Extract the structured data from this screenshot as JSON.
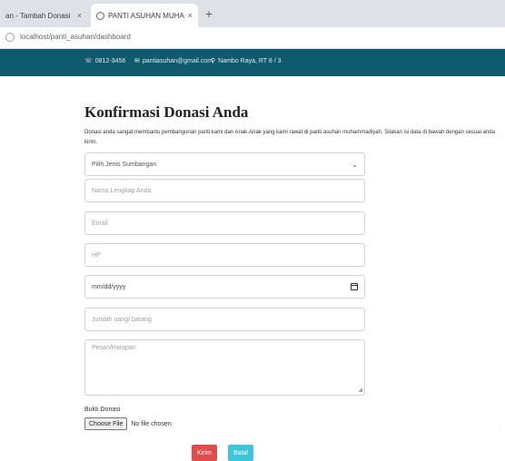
{
  "browser": {
    "tabs": [
      {
        "label": "an - Tambah Donasi"
      },
      {
        "label": "PANTI ASUHAN MUHAMMADIY"
      }
    ],
    "new_tab": "+",
    "address": "localhost/panti_asuhan/dashboard"
  },
  "topbar": {
    "phone": "0812-3456",
    "email": "pantiasuhan@gmail.com",
    "address": "Nambo Raya, RT 8 / 3"
  },
  "form": {
    "title": "Konfirmasi Donasi Anda",
    "description": "Donasi anda sangat membantu pembangunan panti kami dan Anak-Anak yang kami rawat di panti asuhan muhammadiyah. Silakan isi data di bawah dengan sesuai anda kirim.",
    "select": {
      "value": "Pilih Jenis Sumbangan"
    },
    "name": {
      "placeholder": "Nama Lengkap Anda"
    },
    "email": {
      "placeholder": "Email"
    },
    "hp": {
      "placeholder": "HP"
    },
    "date": {
      "value": "mm/dd/yyyy"
    },
    "amount": {
      "placeholder": "Jumlah uang/ barang"
    },
    "message": {
      "placeholder": "Pesan/Harapan"
    },
    "proof_label": "Bukti Donasi",
    "file_button": "Choose File",
    "file_status": "No file chosen",
    "submit_label": "Kirim",
    "reset_label": "Batal"
  },
  "colors": {
    "header": "#0f5a6d",
    "submit": "#e04b4b",
    "reset": "#40c4dc"
  }
}
